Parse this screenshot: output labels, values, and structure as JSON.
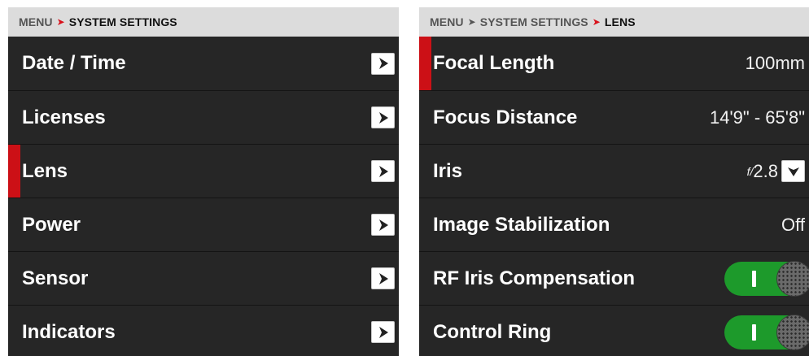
{
  "left": {
    "breadcrumb": {
      "root": "MENU",
      "current": "SYSTEM SETTINGS"
    },
    "items": [
      {
        "label": "Date / Time"
      },
      {
        "label": "Licenses"
      },
      {
        "label": "Lens"
      },
      {
        "label": "Power"
      },
      {
        "label": "Sensor"
      },
      {
        "label": "Indicators"
      }
    ]
  },
  "right": {
    "breadcrumb": {
      "root": "MENU",
      "middle": "SYSTEM SETTINGS",
      "current": "LENS"
    },
    "focal_length": {
      "label": "Focal Length",
      "value": "100mm"
    },
    "focus_distance": {
      "label": "Focus Distance",
      "value": "14'9\" - 65'8\""
    },
    "iris": {
      "label": "Iris",
      "symbol": "f/",
      "value": "2.8"
    },
    "image_stabilization": {
      "label": "Image Stabilization",
      "value": "Off"
    },
    "rf_iris_compensation": {
      "label": "RF Iris Compensation",
      "enabled": true
    },
    "control_ring": {
      "label": "Control Ring",
      "enabled": true
    }
  },
  "colors": {
    "accent_red": "#cc1016",
    "toggle_on": "#1d9a2b",
    "panel_bg": "#262626",
    "breadcrumb_bg": "#dcdcdc"
  },
  "icons": {
    "submenu_arrow": "chevron-right-icon",
    "dropdown": "chevron-down-icon",
    "selection_marker": "selection-marker"
  }
}
